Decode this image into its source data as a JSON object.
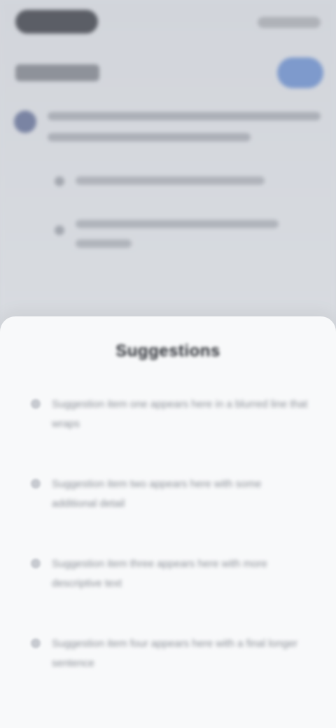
{
  "sheet": {
    "title": "Suggestions",
    "items": [
      {
        "text": "Suggestion item one appears here in a blurred line that wraps"
      },
      {
        "text": "Suggestion item two appears here with some additional detail"
      },
      {
        "text": "Suggestion item three appears here with more descriptive text"
      },
      {
        "text": "Suggestion item four appears here with a final longer sentence"
      }
    ]
  },
  "colors": {
    "backdrop": "#d4d7dd",
    "sheet": "#f8f9fa",
    "accent": "#6f8fc9"
  }
}
